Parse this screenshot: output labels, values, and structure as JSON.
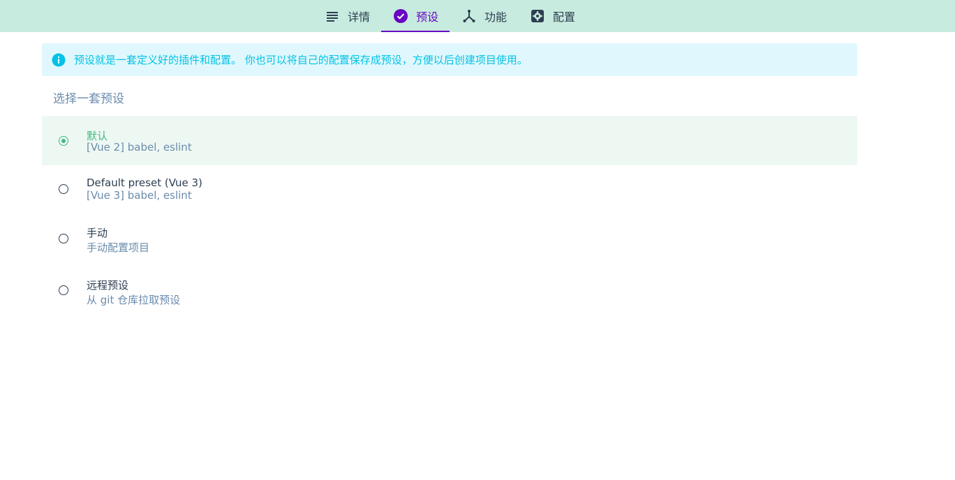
{
  "colors": {
    "topbar_bg": "#c7ebdf",
    "active_tab": "#6806c1",
    "selected_accent": "#42b983",
    "info_text": "#03c2e6",
    "info_bg": "#e0f8fd",
    "muted_text": "#6a8bad"
  },
  "tabs": [
    {
      "label": "详情",
      "icon": "list-icon",
      "active": false
    },
    {
      "label": "预设",
      "icon": "check-circle-icon",
      "active": true
    },
    {
      "label": "功能",
      "icon": "branch-icon",
      "active": false
    },
    {
      "label": "配置",
      "icon": "gear-icon",
      "active": false
    }
  ],
  "info": {
    "icon": "info-icon",
    "text": "预设就是一套定义好的插件和配置。 你也可以将自己的配置保存成预设，方便以后创建项目使用。"
  },
  "section_title": "选择一套预设",
  "presets": [
    {
      "name": "默认",
      "description": "[Vue 2] babel, eslint",
      "selected": true
    },
    {
      "name": "Default preset (Vue 3)",
      "description": "[Vue 3] babel, eslint",
      "selected": false
    },
    {
      "name": "手动",
      "description": "手动配置项目",
      "selected": false
    },
    {
      "name": "远程预设",
      "description": "从 git 仓库拉取预设",
      "selected": false
    }
  ]
}
